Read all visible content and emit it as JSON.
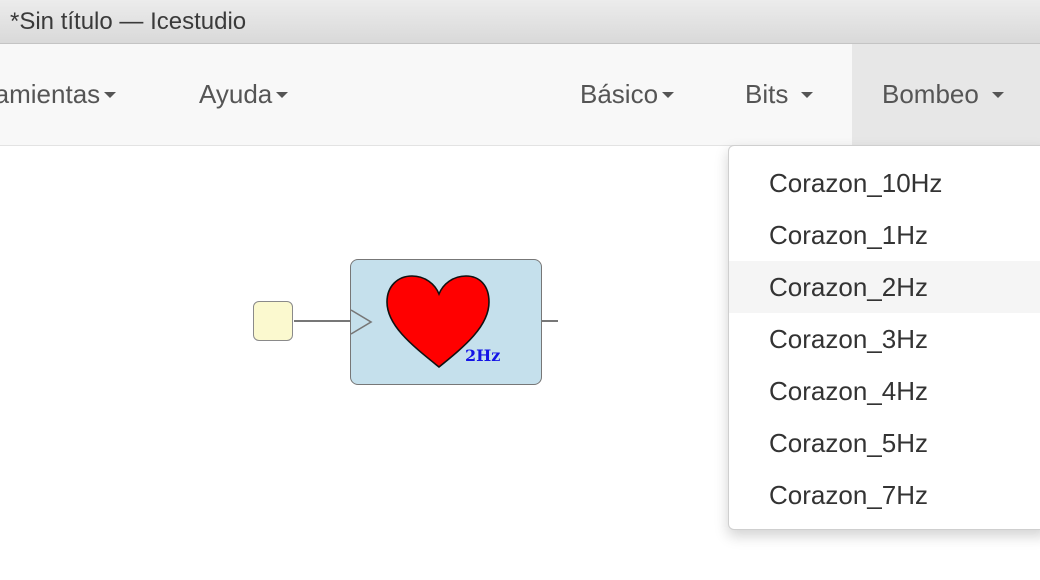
{
  "window": {
    "title": "*Sin título — Icestudio"
  },
  "menubar": {
    "left": [
      {
        "label": "ramientas"
      },
      {
        "label": "Ayuda"
      }
    ],
    "right": [
      {
        "label": "Básico"
      },
      {
        "label": "Bits"
      },
      {
        "label": "Bombeo",
        "active": true
      }
    ]
  },
  "dropdown": {
    "items": [
      {
        "label": "Corazon_10Hz"
      },
      {
        "label": "Corazon_1Hz"
      },
      {
        "label": "Corazon_2Hz",
        "hovered": true
      },
      {
        "label": "Corazon_3Hz"
      },
      {
        "label": "Corazon_4Hz"
      },
      {
        "label": "Corazon_5Hz"
      },
      {
        "label": "Corazon_7Hz"
      }
    ]
  },
  "canvas": {
    "block": {
      "label": "2Hz",
      "icon": "heart-icon",
      "colors": {
        "fill": "#c5e0ec",
        "heart": "#ff0000",
        "label": "#1414e6"
      }
    },
    "input_port": {
      "color": "#fbf9cf"
    }
  }
}
